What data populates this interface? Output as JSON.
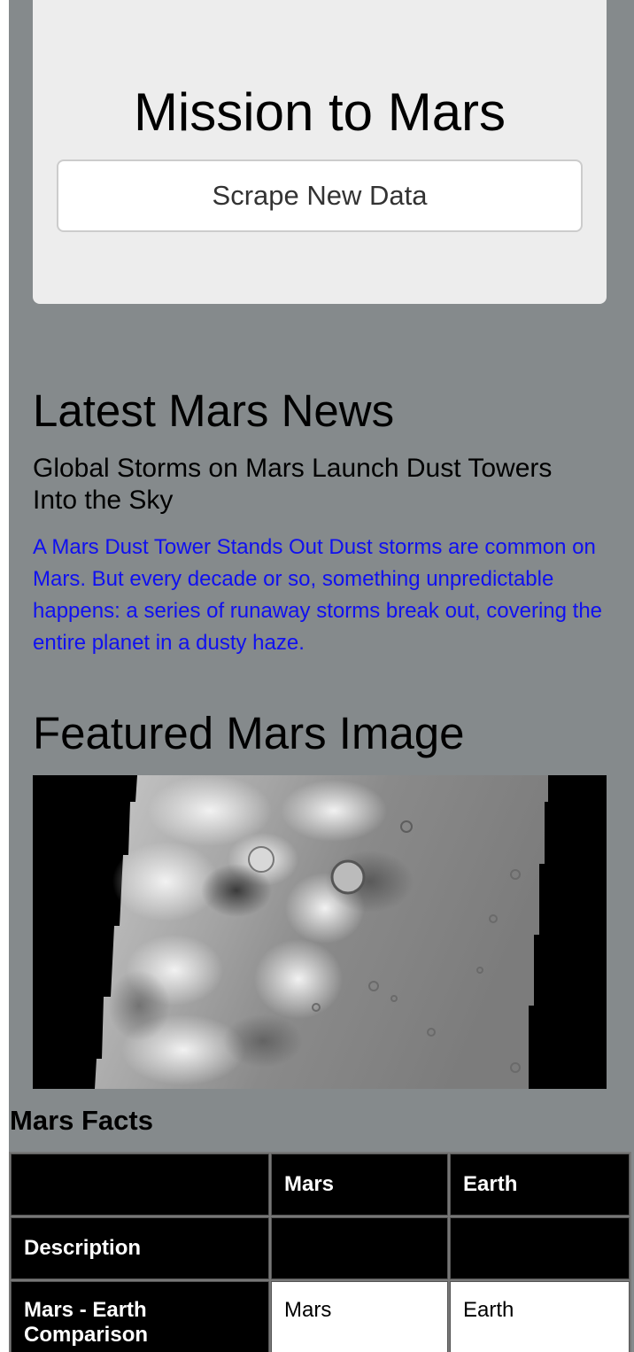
{
  "jumbotron": {
    "title": "Mission to Mars",
    "scrape_button": "Scrape New Data"
  },
  "news": {
    "heading": "Latest Mars News",
    "title": "Global Storms on Mars Launch Dust Towers Into the Sky",
    "paragraph": "A Mars Dust Tower Stands Out Dust storms are common on Mars. But every decade or so, something unpredictable happens: a series of runaway storms break out, covering the entire planet in a dusty haze."
  },
  "featured": {
    "heading": "Featured Mars Image"
  },
  "facts": {
    "heading": "Mars Facts",
    "columns": [
      "",
      "Mars",
      "Earth"
    ],
    "rows": [
      [
        "Description",
        "",
        ""
      ],
      [
        "Mars - Earth Comparison",
        "Mars",
        "Earth"
      ]
    ]
  },
  "colors": {
    "page_background": "#858a8c",
    "jumbotron_background": "#ededed",
    "news_paragraph_text": "#1010f0",
    "table_dark_cell": "#000000"
  }
}
